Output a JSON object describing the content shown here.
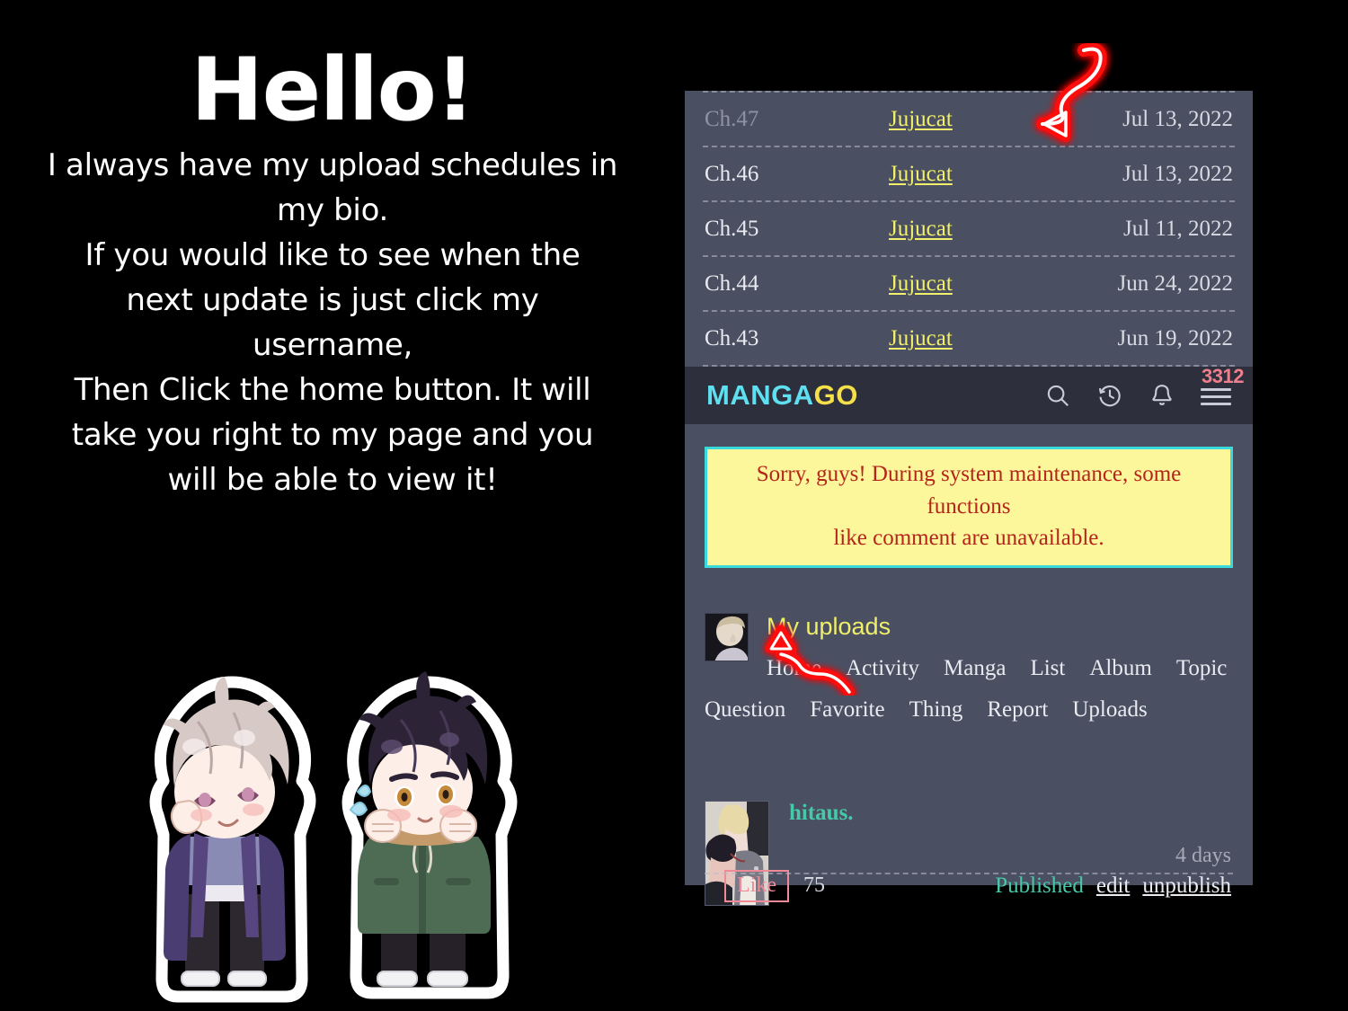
{
  "note": {
    "title": "Hello!",
    "lines": [
      "I always have my upload schedules in",
      "my bio.",
      "If you would like to see when the",
      "next update is just click my",
      "username,",
      "Then Click the home button. It will",
      "take you right to my page and you",
      "will be able to view it!"
    ]
  },
  "chapter_list": {
    "rows": [
      {
        "chapter": "Ch.47",
        "uploader": "Jujucat",
        "date": "Jul 13, 2022",
        "read": true
      },
      {
        "chapter": "Ch.46",
        "uploader": "Jujucat",
        "date": "Jul 13, 2022",
        "read": false
      },
      {
        "chapter": "Ch.45",
        "uploader": "Jujucat",
        "date": "Jul 11, 2022",
        "read": false
      },
      {
        "chapter": "Ch.44",
        "uploader": "Jujucat",
        "date": "Jun 24, 2022",
        "read": false
      },
      {
        "chapter": "Ch.43",
        "uploader": "Jujucat",
        "date": "Jun 19, 2022",
        "read": false
      }
    ]
  },
  "appbar": {
    "logo_part1": "MANGA",
    "logo_part2": "GO",
    "logo_color1": "#5ee0f0",
    "logo_color2": "#f5e04a",
    "notification_count": "3312",
    "badge_color": "#f07f8e",
    "icons": [
      "search-icon",
      "history-icon",
      "bell-icon",
      "hamburger-menu-icon"
    ]
  },
  "banner": {
    "line1": "Sorry, guys! During system maintenance, some functions",
    "line2": "like comment are unavailable.",
    "background": "#fcf79b",
    "border_color": "#3ad9db",
    "text_color": "#b5251b"
  },
  "profile": {
    "title": "My uploads",
    "title_color": "#f0ef6a",
    "nav_row1": [
      "Home",
      "Activity",
      "Manga",
      "List",
      "Album",
      "Topic"
    ],
    "nav_row2": [
      "Question",
      "Favorite",
      "Thing",
      "Report",
      "Uploads"
    ]
  },
  "post": {
    "title": "hitaus.",
    "title_color": "#46c9a8",
    "age": "4 days",
    "like_label": "Like",
    "like_count": "75",
    "status": "Published",
    "actions": [
      "edit",
      "unpublish"
    ]
  },
  "annotations": {
    "arrow_top": "red-arrow-pointing-to-username",
    "arrow_home": "red-arrow-pointing-to-home-link",
    "arrow_color": "#ff0d0d"
  }
}
